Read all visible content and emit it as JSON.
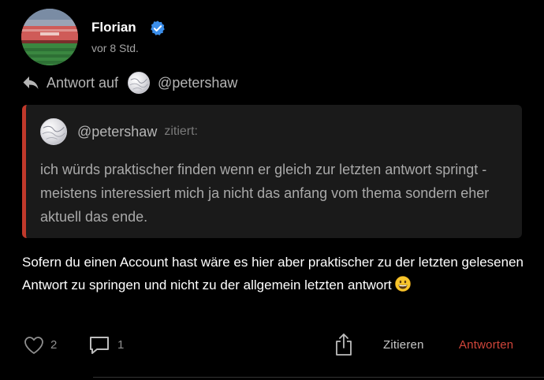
{
  "post": {
    "author": "Florian",
    "time": "vor 8 Std.",
    "reply_to_label": "Antwort auf",
    "reply_to_user": "@petershaw",
    "quote": {
      "user": "@petershaw",
      "cites_label": "zitiert:",
      "text": "ich würds praktischer finden wenn er gleich zur letzten antwort springt - meistens interessiert mich ja nicht das anfang vom thema sondern eher aktuell das ende."
    },
    "body": "Sofern du einen Account hast wäre es hier aber praktischer zu der letzten gelesenen Antwort zu springen und nicht zu der allgemein letzten antwort",
    "likes": "2",
    "replies": "1",
    "actions": {
      "quote": "Zitieren",
      "answer": "Antworten"
    }
  },
  "colors": {
    "background": "#000000",
    "quote_bg": "#1a1a1a",
    "quote_bar": "#c0392b",
    "accent_red": "#d0453a",
    "verified_blue": "#3b8eea"
  },
  "icons": {
    "verified": "verified-badge-icon",
    "reply": "reply-arrow-icon",
    "like": "heart-icon",
    "comment": "speech-bubble-icon",
    "share": "share-icon",
    "emoji": "smiley-emoji-icon"
  }
}
